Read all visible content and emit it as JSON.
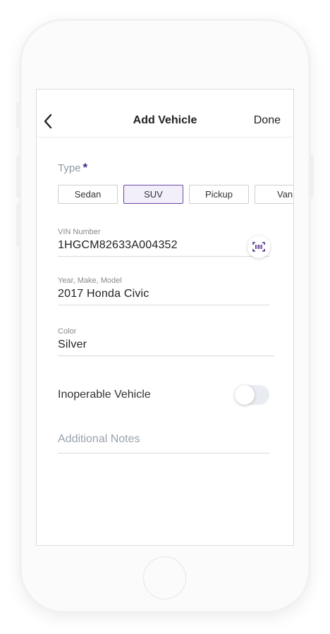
{
  "header": {
    "title": "Add Vehicle",
    "done_label": "Done"
  },
  "type": {
    "label": "Type",
    "required_mark": "*",
    "options": [
      "Sedan",
      "SUV",
      "Pickup",
      "Van"
    ],
    "selected": "SUV"
  },
  "vin": {
    "label": "VIN Number",
    "value": "1HGCM82633A004352",
    "scan_icon": "barcode-scan-icon"
  },
  "year_make_model": {
    "label": "Year, Make, Model",
    "value": "2017 Honda Civic"
  },
  "color": {
    "label": "Color",
    "value": "Silver"
  },
  "inoperable": {
    "label": "Inoperable Vehicle",
    "enabled": false
  },
  "notes": {
    "placeholder": "Additional Notes"
  },
  "colors": {
    "accent": "#4b2a86",
    "selected_chip_bg": "#f3effa",
    "toggle_off": "#e9edf1"
  }
}
